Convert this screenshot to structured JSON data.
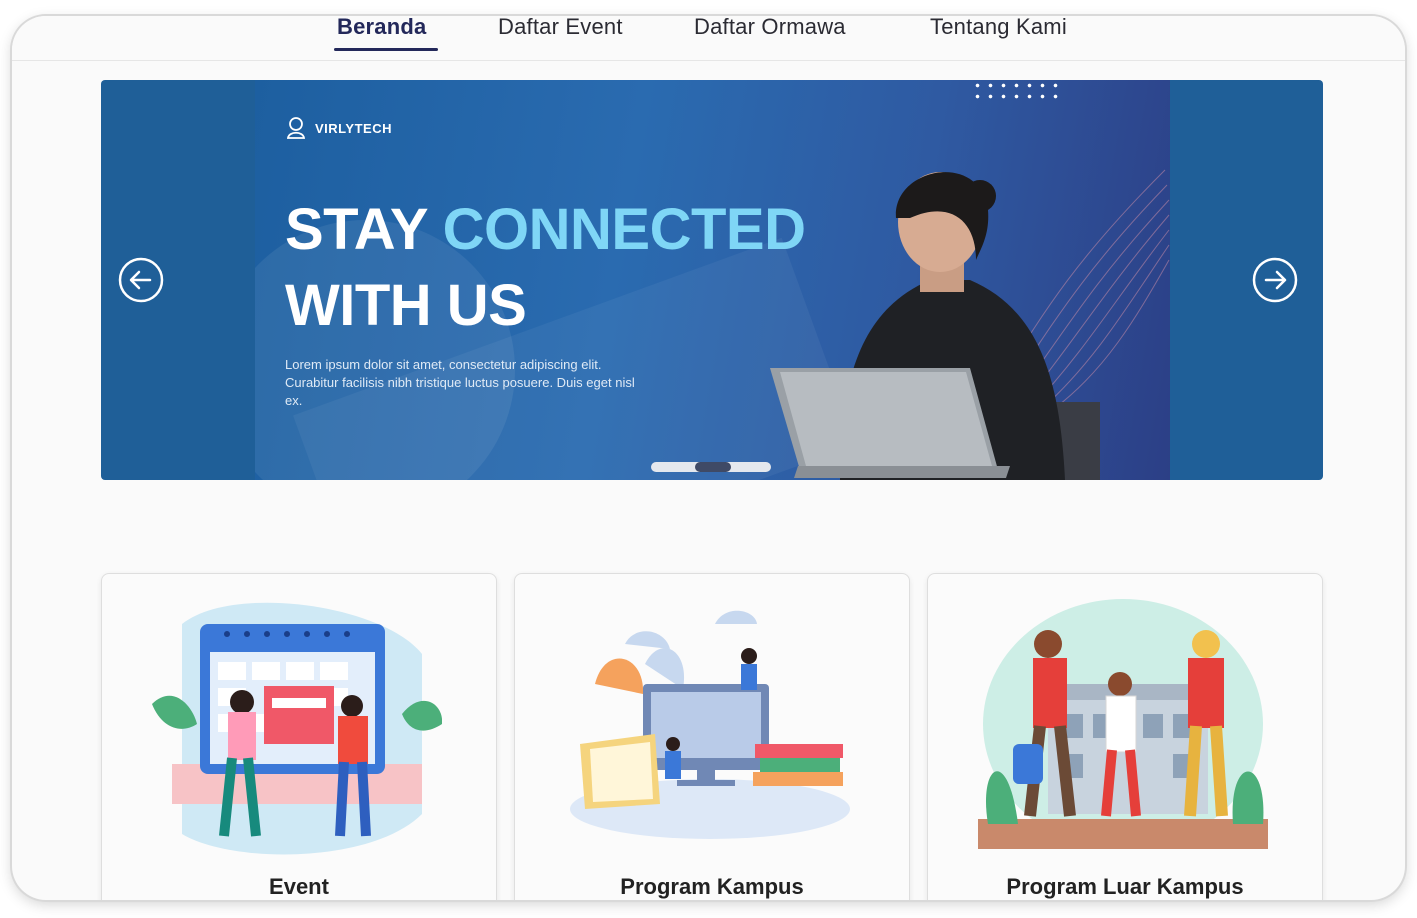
{
  "nav": {
    "items": [
      {
        "label": "Beranda",
        "active": true
      },
      {
        "label": "Daftar Event",
        "active": false
      },
      {
        "label": "Daftar Ormawa",
        "active": false
      },
      {
        "label": "Tentang Kami",
        "active": false
      }
    ]
  },
  "carousel": {
    "brand": "VIRLYTECH",
    "headline_part1": "STAY ",
    "headline_accent": "CONNECTED",
    "headline_line2": "WITH US",
    "body": "Lorem ipsum dolor sit amet, consectetur adipiscing elit. Curabitur facilisis nibh tristique luctus posuere. Duis eget nisl ex.",
    "prev_icon": "arrow-left-circle-icon",
    "next_icon": "arrow-right-circle-icon",
    "slide_count": 3,
    "active_slide": 2
  },
  "cards": [
    {
      "title": "Event",
      "illustration": "calendar-people-illustration"
    },
    {
      "title": "Program Kampus",
      "illustration": "books-computer-illustration"
    },
    {
      "title": "Program Luar Kampus",
      "illustration": "students-walking-illustration"
    }
  ],
  "colors": {
    "nav_active": "#23285a",
    "banner_blue": "#1f5f98",
    "headline_accent": "#7fd6f6",
    "background": "#fafafa"
  }
}
